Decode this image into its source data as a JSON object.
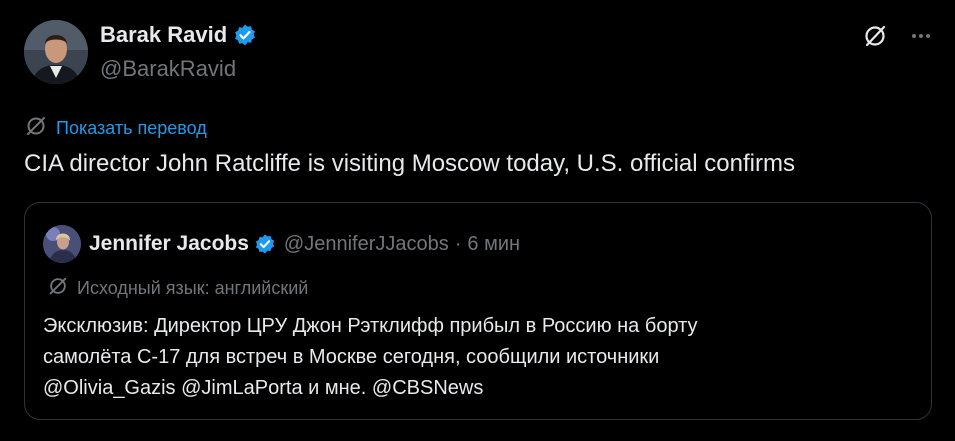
{
  "tweet": {
    "author": {
      "name": "Barak Ravid",
      "handle": "@BarakRavid"
    },
    "translate_label": "Показать перевод",
    "text": "CIA director John Ratcliffe is visiting Moscow today, U.S. official confirms",
    "icons": [
      "no-translate-icon",
      "more-options-icon",
      "verified-badge-icon",
      "translate-icon"
    ]
  },
  "quote": {
    "author": {
      "name": "Jennifer Jacobs",
      "handle": "@JenniferJJacobs"
    },
    "separator": "·",
    "time": "6 мин",
    "language_note": "Исходный язык: английский",
    "text_lines": [
      "Эксклюзив: Директор ЦРУ Джон Рэтклифф прибыл в Россию на борту",
      "самолёта С-17 для встреч в Москве сегодня, сообщили источники",
      "@Olivia_Gazis @JimLaPorta и мне. @CBSNews"
    ]
  },
  "colors": {
    "background": "#000000",
    "text": "#e7e9ea",
    "secondary": "#71767b",
    "accent": "#1d9bf0",
    "border": "#2f3336"
  }
}
